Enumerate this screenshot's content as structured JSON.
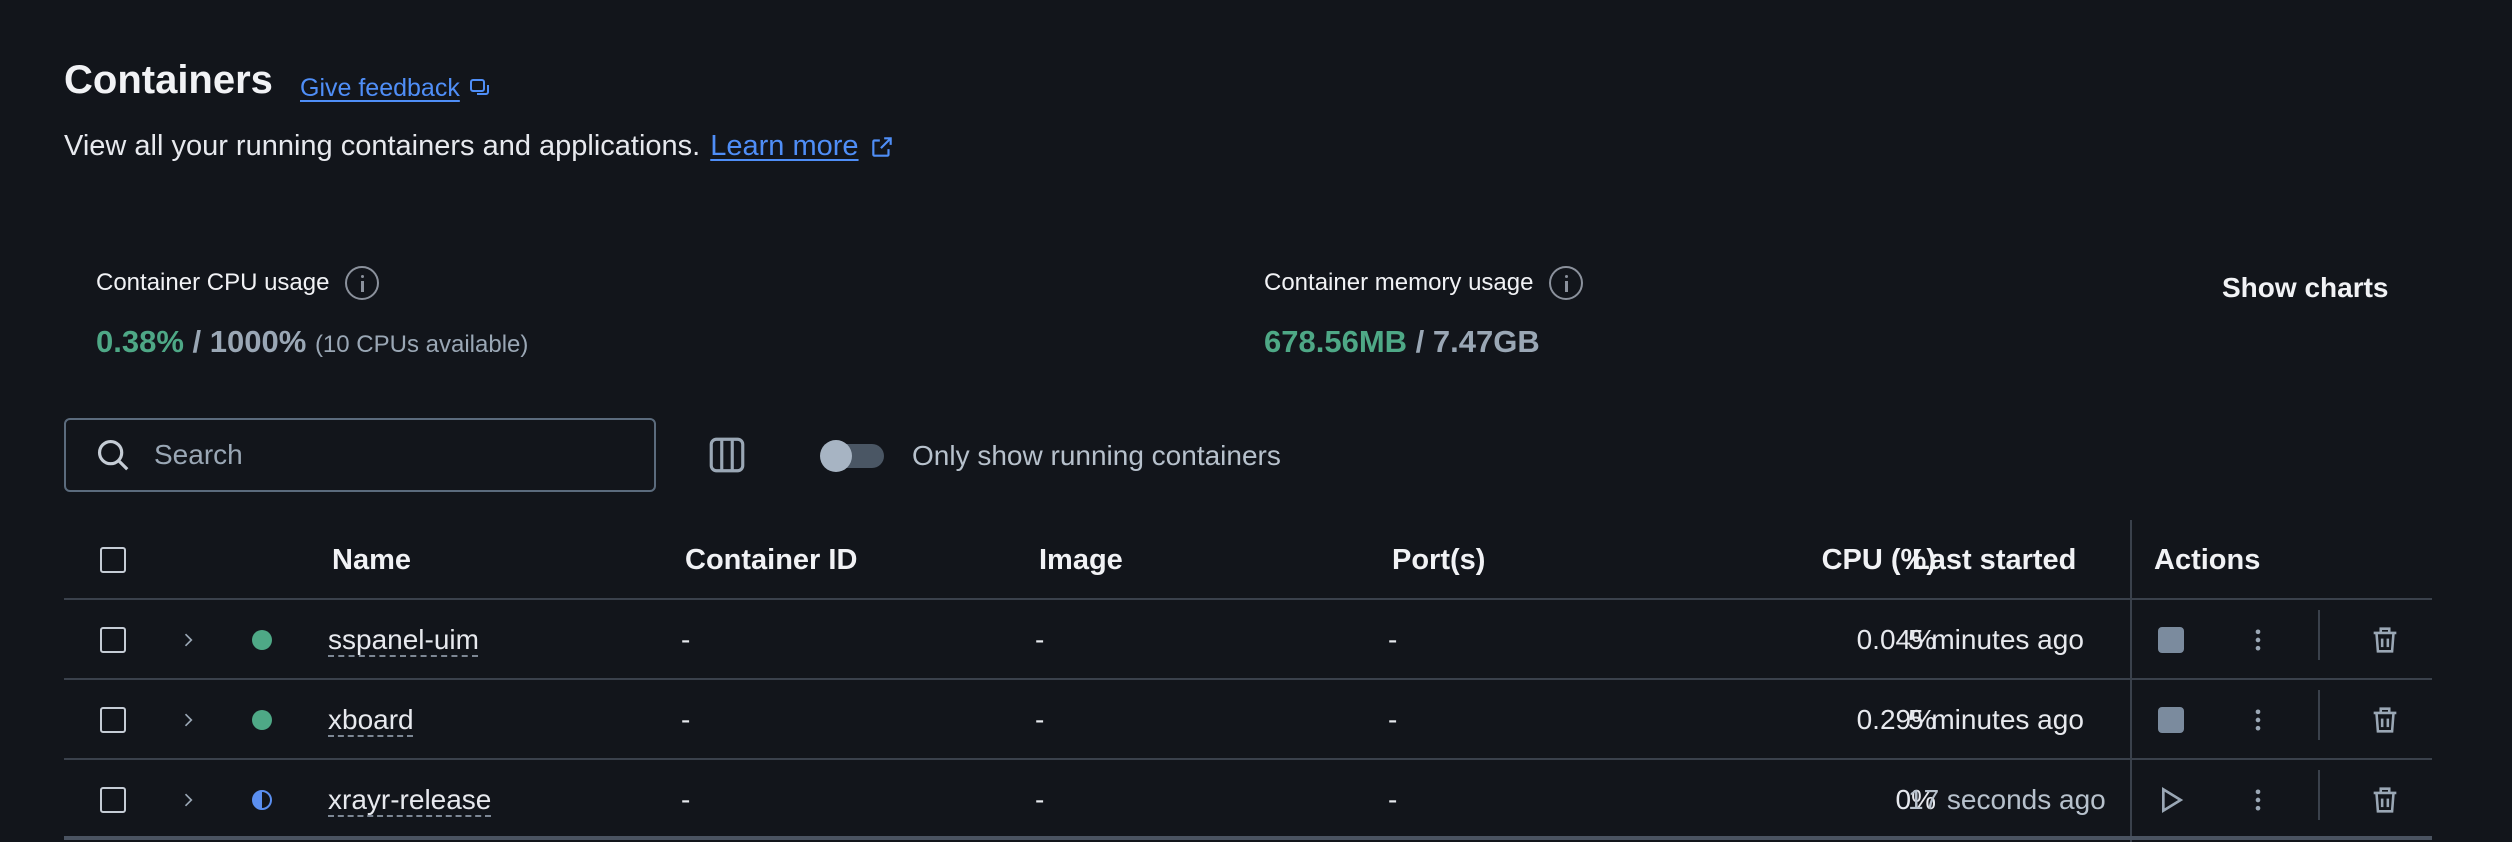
{
  "header": {
    "title": "Containers",
    "feedback_label": "Give feedback",
    "subtitle": "View all your running containers and applications.",
    "learn_more_label": "Learn more"
  },
  "stats": {
    "cpu": {
      "label": "Container CPU usage",
      "used": "0.38%",
      "separator": "/",
      "total": "1000%",
      "note": "(10 CPUs available)"
    },
    "memory": {
      "label": "Container memory usage",
      "used": "678.56MB",
      "separator": "/",
      "total": "7.47GB"
    },
    "show_charts_label": "Show charts"
  },
  "toolbar": {
    "search_placeholder": "Search",
    "toggle_label": "Only show running containers",
    "toggle_on": false
  },
  "table": {
    "columns": {
      "name": "Name",
      "container_id": "Container ID",
      "image": "Image",
      "ports": "Port(s)",
      "cpu": "CPU (%)",
      "last_started": "Last started",
      "actions": "Actions"
    },
    "rows": [
      {
        "name": "sspanel-uim",
        "container_id": "-",
        "image": "-",
        "ports": "-",
        "cpu": "0.04%",
        "last_started": "5 minutes ago",
        "status": "running"
      },
      {
        "name": "xboard",
        "container_id": "-",
        "image": "-",
        "ports": "-",
        "cpu": "0.29%",
        "last_started": "5 minutes ago",
        "status": "running"
      },
      {
        "name": "xrayr-release",
        "container_id": "-",
        "image": "-",
        "ports": "-",
        "cpu": "0%",
        "last_started": "17 seconds ago",
        "status": "partial"
      }
    ]
  },
  "colors": {
    "background": "#12151b",
    "accent_link": "#4f8ef7",
    "running_green": "#4ea886",
    "partial_blue": "#5b8ff0"
  }
}
